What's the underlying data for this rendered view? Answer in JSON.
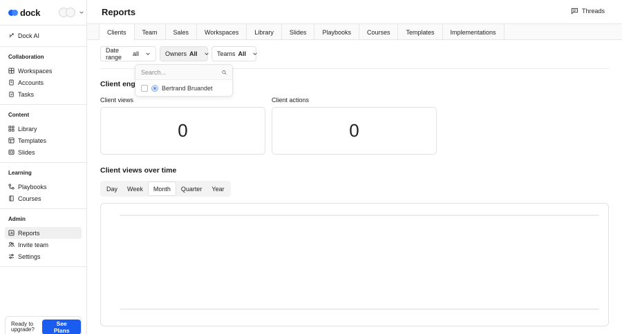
{
  "app": {
    "logo_text": "dock"
  },
  "sidebar": {
    "dock_ai": "Dock AI",
    "sections": {
      "collaboration": {
        "title": "Collaboration",
        "items": [
          "Workspaces",
          "Accounts",
          "Tasks"
        ]
      },
      "content": {
        "title": "Content",
        "items": [
          "Library",
          "Templates",
          "Slides"
        ]
      },
      "learning": {
        "title": "Learning",
        "items": [
          "Playbooks",
          "Courses"
        ]
      },
      "admin": {
        "title": "Admin",
        "items": [
          "Reports",
          "Invite team",
          "Settings"
        ]
      }
    },
    "upgrade": {
      "text": "Ready to upgrade?",
      "button": "See Plans"
    }
  },
  "header": {
    "title": "Reports",
    "threads": "Threads"
  },
  "tabs": [
    "Clients",
    "Team",
    "Sales",
    "Workspaces",
    "Library",
    "Slides",
    "Playbooks",
    "Courses",
    "Templates",
    "Implementations"
  ],
  "filters": {
    "date_range": {
      "label": "Date range",
      "value": "all"
    },
    "owners": {
      "label": "Owners",
      "value": "All"
    },
    "teams": {
      "label": "Teams",
      "value": "All"
    }
  },
  "owners_dropdown": {
    "placeholder": "Search...",
    "options": [
      "Bertrand Bruandet"
    ]
  },
  "engagement": {
    "title": "Client engagement",
    "views_label": "Client views",
    "views_value": "0",
    "actions_label": "Client actions",
    "actions_value": "0"
  },
  "views_over_time": {
    "title": "Client views over time",
    "periods": [
      "Day",
      "Week",
      "Month",
      "Quarter",
      "Year"
    ],
    "selected_period": "Month"
  },
  "colors": {
    "accent": "#1a5cf0",
    "logo": "#1a63f5"
  }
}
